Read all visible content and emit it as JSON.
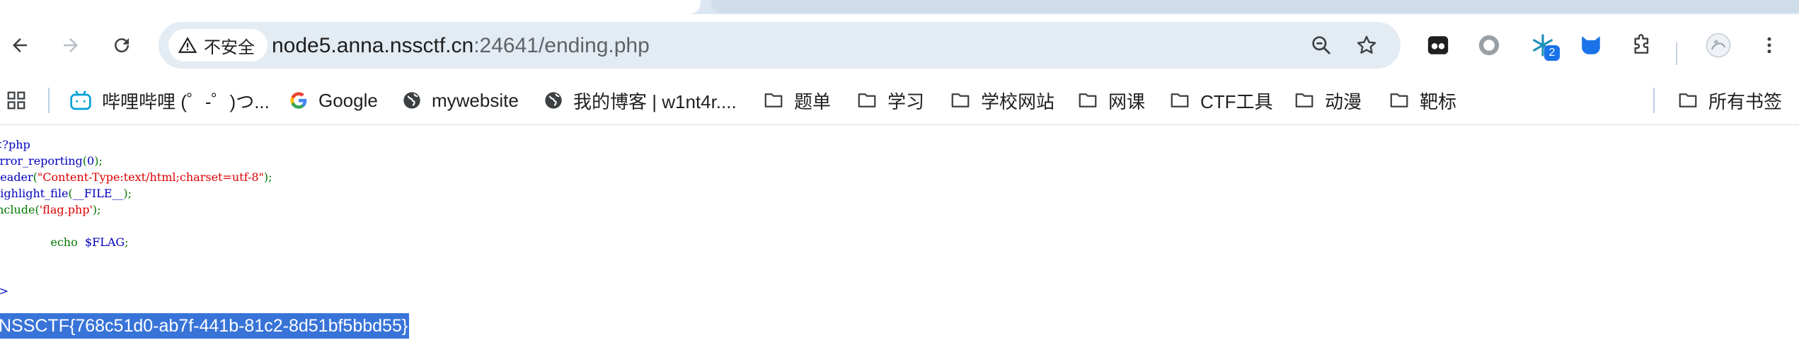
{
  "toolbar": {
    "security_label": "不安全",
    "url_host": "node5.anna.nssctf.cn",
    "url_rest": ":24641/ending.php",
    "extension_badge": "2"
  },
  "bookmarks": {
    "items": [
      {
        "label": "哔哩哔哩 (゜-゜)つ...",
        "icon": "bilibili-icon"
      },
      {
        "label": "Google",
        "icon": "google-icon"
      },
      {
        "label": "mywebsite",
        "icon": "globe-icon"
      },
      {
        "label": "我的博客 | w1nt4r....",
        "icon": "globe-icon"
      },
      {
        "label": "题单",
        "icon": "folder-icon"
      },
      {
        "label": "学习",
        "icon": "folder-icon"
      },
      {
        "label": "学校网站",
        "icon": "folder-icon"
      },
      {
        "label": "网课",
        "icon": "folder-icon"
      },
      {
        "label": "CTF工具",
        "icon": "folder-icon"
      },
      {
        "label": "动漫",
        "icon": "folder-icon"
      },
      {
        "label": "靶标",
        "icon": "folder-icon"
      }
    ],
    "all_bookmarks": "所有书签"
  },
  "code": {
    "line1": "<?php",
    "line2_fn": "error_reporting",
    "line2_open": "(",
    "line2_arg": "0",
    "line2_close": ");",
    "line3_fn": "header",
    "line3_open": "(",
    "line3_arg": "\"Content-Type:text/html;charset=utf-8\"",
    "line3_close": ");",
    "line4_fn": "highlight_file",
    "line4_open": "(",
    "line4_arg": "__FILE__",
    "line4_close": ");",
    "line5_kw": "include(",
    "line5_arg": "'flag.php'",
    "line5_close": ");",
    "line7_kw": "echo ",
    "line7_var": "$FLAG",
    "line7_end": ";",
    "line10": "?>"
  },
  "output": {
    "flag": "NSSCTF{768c51d0-ab7f-441b-81c2-8d51bf5bbd55}"
  },
  "colors": {
    "php_default": "#0000bb",
    "php_keyword": "#007700",
    "php_string": "#dd0000",
    "selection": "#3874d8"
  }
}
